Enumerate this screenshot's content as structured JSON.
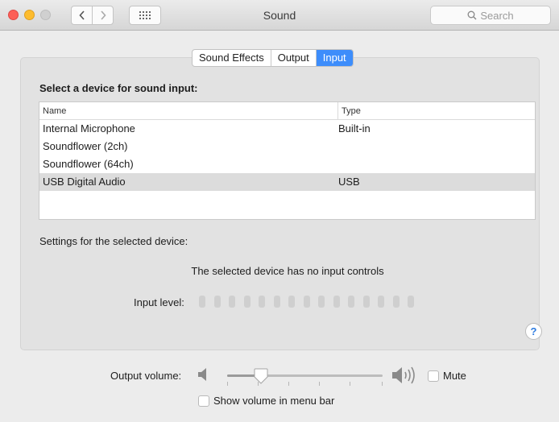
{
  "window": {
    "title": "Sound"
  },
  "search": {
    "placeholder": "Search"
  },
  "tabs": [
    {
      "label": "Sound Effects",
      "active": false
    },
    {
      "label": "Output",
      "active": false
    },
    {
      "label": "Input",
      "active": true
    }
  ],
  "input": {
    "section_title": "Select a device for sound input:",
    "columns": {
      "name": "Name",
      "type": "Type"
    },
    "devices": [
      {
        "name": "Internal Microphone",
        "type": "Built-in",
        "selected": false
      },
      {
        "name": "Soundflower (2ch)",
        "type": "",
        "selected": false
      },
      {
        "name": "Soundflower (64ch)",
        "type": "",
        "selected": false
      },
      {
        "name": "USB Digital Audio",
        "type": "USB",
        "selected": true
      }
    ],
    "settings_label": "Settings for the selected device:",
    "no_controls_text": "The selected device has no input controls",
    "input_level_label": "Input level:",
    "input_level_segments": 15
  },
  "help_label": "?",
  "output": {
    "volume_label": "Output volume:",
    "volume_fraction": 0.22,
    "mute_label": "Mute",
    "mute_checked": false,
    "show_in_menubar_label": "Show volume in menu bar",
    "show_in_menubar_checked": false
  },
  "colors": {
    "accent": "#3d8dfb",
    "close": "#fc5f57",
    "minimize": "#fdbc2e",
    "panel": "#e2e2e2"
  }
}
